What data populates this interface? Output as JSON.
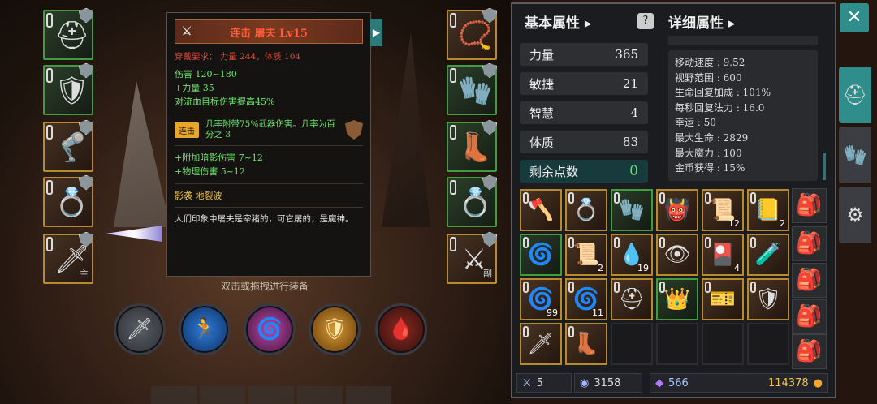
{
  "tooltip": {
    "title": "连击 屠夫 Lv15",
    "requirement": "穿戴要求： 力量 244，体质 104",
    "stats": [
      "伤害 120~180",
      "+力量 35",
      "对流血目标伤害提高45%"
    ],
    "combo_label": "连击",
    "combo_text": "几率附带75%武器伤害。几率为百分之 3",
    "bonus": [
      "+附加暗影伤害 7~12",
      "+物理伤害 5~12"
    ],
    "set": "影袭 地裂波",
    "description": "人们印象中屠夫是宰猪的，可它屠的，是魔神。"
  },
  "equip_hint": "双击或拖拽进行装备",
  "left_slots": [
    {
      "icon": "helmet-icon",
      "glyph": "⛑",
      "tag": ""
    },
    {
      "icon": "chest-armor-icon",
      "glyph": "🛡",
      "tag": ""
    },
    {
      "icon": "leg-armor-icon",
      "glyph": "🦿",
      "tag": ""
    },
    {
      "icon": "ring-icon",
      "glyph": "💍",
      "tag": ""
    },
    {
      "icon": "sword-icon",
      "glyph": "🗡",
      "tag": "主"
    }
  ],
  "right_slots": [
    {
      "icon": "amulet-icon",
      "glyph": "📿",
      "tag": ""
    },
    {
      "icon": "gloves-icon",
      "glyph": "🧤",
      "tag": ""
    },
    {
      "icon": "boots-icon",
      "glyph": "👢",
      "tag": ""
    },
    {
      "icon": "ring-icon",
      "glyph": "💍",
      "tag": ""
    },
    {
      "icon": "crossed-swords-icon",
      "glyph": "⚔",
      "tag": "副"
    }
  ],
  "panel": {
    "basic_title": "基本属性",
    "detail_title": "详细属性",
    "attributes": [
      {
        "name": "力量",
        "value": "365"
      },
      {
        "name": "敏捷",
        "value": "21"
      },
      {
        "name": "智慧",
        "value": "4"
      },
      {
        "name": "体质",
        "value": "83"
      }
    ],
    "points": {
      "name": "剩余点数",
      "value": "0"
    },
    "details": [
      "移动速度 : 9.52",
      "视野范围 : 600",
      "生命回复加成 : 101%",
      "每秒回复法力 : 16.0",
      "幸运 : 50",
      "最大生命 : 2829",
      "最大魔力 : 100",
      "金币获得 : 15%"
    ]
  },
  "inventory": [
    {
      "glyph": "🪓",
      "count": "",
      "style": "gold"
    },
    {
      "glyph": "💍",
      "count": "",
      "style": "gold"
    },
    {
      "glyph": "🧤",
      "count": "",
      "style": "g"
    },
    {
      "glyph": "👹",
      "count": "",
      "style": "gold"
    },
    {
      "glyph": "📜",
      "count": "12",
      "style": "gold"
    },
    {
      "glyph": "📒",
      "count": "2",
      "style": "gold"
    },
    {
      "glyph": "🌀",
      "count": "",
      "style": "g"
    },
    {
      "glyph": "📜",
      "count": "2",
      "style": "gold"
    },
    {
      "glyph": "💧",
      "count": "19",
      "style": "gold"
    },
    {
      "glyph": "👁",
      "count": "",
      "style": "gold"
    },
    {
      "glyph": "🎴",
      "count": "4",
      "style": "gold"
    },
    {
      "glyph": "🧪",
      "count": "",
      "style": "gold"
    },
    {
      "glyph": "🌀",
      "count": "99",
      "style": "gold"
    },
    {
      "glyph": "🌀",
      "count": "11",
      "style": "gold"
    },
    {
      "glyph": "⛑",
      "count": "",
      "style": "gold"
    },
    {
      "glyph": "👑",
      "count": "",
      "style": "g"
    },
    {
      "glyph": "🎫",
      "count": "",
      "style": "gold"
    },
    {
      "glyph": "🛡",
      "count": "",
      "style": "gold"
    },
    {
      "glyph": "🗡",
      "count": "",
      "style": "gold"
    },
    {
      "glyph": "👢",
      "count": "",
      "style": "gold"
    },
    {
      "glyph": "",
      "count": "",
      "style": "e"
    },
    {
      "glyph": "",
      "count": "",
      "style": "e"
    },
    {
      "glyph": "",
      "count": "",
      "style": "e"
    },
    {
      "glyph": "",
      "count": "",
      "style": "e"
    }
  ],
  "currency": {
    "swords": "5",
    "orbs": "3158",
    "gems": "566",
    "gold": "114378"
  },
  "side_tabs": [
    {
      "icon": "helmet-icon",
      "glyph": "⛑"
    },
    {
      "icon": "gloves-icon",
      "glyph": "🧤"
    },
    {
      "icon": "settings-icon",
      "glyph": "⚙"
    }
  ]
}
